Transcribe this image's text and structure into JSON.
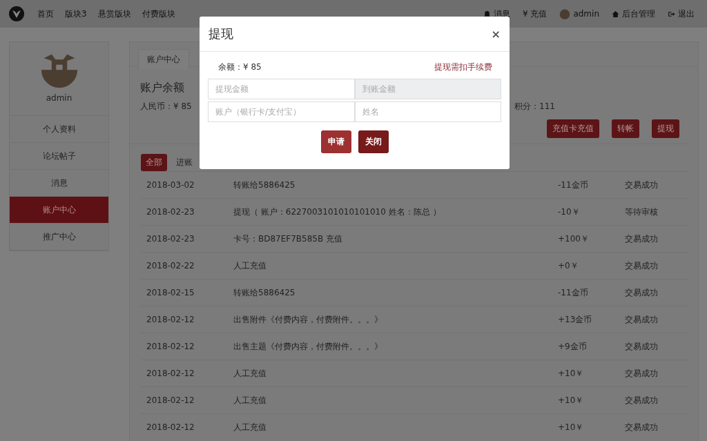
{
  "navbar": {
    "left": [
      {
        "label": "首页"
      },
      {
        "label": "版块3"
      },
      {
        "label": "悬赏版块"
      },
      {
        "label": "付费版块"
      }
    ],
    "right": [
      {
        "kind": "bell",
        "label": "消息"
      },
      {
        "kind": "text",
        "label": "¥ 充值"
      },
      {
        "kind": "avatar",
        "label": "admin"
      },
      {
        "kind": "home",
        "label": "后台管理"
      },
      {
        "kind": "exit",
        "label": "退出"
      }
    ]
  },
  "sidebar": {
    "username": "admin",
    "items": [
      {
        "label": "个人资料",
        "selected": false
      },
      {
        "label": "论坛帖子",
        "selected": false
      },
      {
        "label": "消息",
        "selected": false
      },
      {
        "label": "账户中心",
        "selected": true
      },
      {
        "label": "推广中心",
        "selected": false
      }
    ]
  },
  "panel": {
    "tab": "账户中心",
    "heading": "账户余额",
    "rmb": "人民币：¥ 85",
    "points": "积分：111",
    "actions": [
      "充值卡充值",
      "转帐",
      "提现"
    ],
    "filters": [
      {
        "label": "全部",
        "selected": true
      },
      {
        "label": "进账",
        "selected": false
      }
    ],
    "rows": [
      {
        "date": "2018-03-02",
        "desc": "转账给5886425",
        "amount": "-11金币",
        "status": "交易成功"
      },
      {
        "date": "2018-02-23",
        "desc": "提现（ 账户：6227003101010101010 姓名：陈总 ）",
        "amount": "-10￥",
        "status": "等待审核"
      },
      {
        "date": "2018-02-23",
        "desc": "卡号：BD87EF7B585B 充值",
        "amount": "+100￥",
        "status": "交易成功"
      },
      {
        "date": "2018-02-22",
        "desc": "人工充值",
        "amount": "+0￥",
        "status": "交易成功"
      },
      {
        "date": "2018-02-15",
        "desc": "转账给5886425",
        "amount": "-11金币",
        "status": "交易成功"
      },
      {
        "date": "2018-02-12",
        "desc": "出售附件《付费内容，付费附件。。。》",
        "amount": "+13金币",
        "status": "交易成功"
      },
      {
        "date": "2018-02-12",
        "desc": "出售主题《付费内容，付费附件。。。》",
        "amount": "+9金币",
        "status": "交易成功"
      },
      {
        "date": "2018-02-12",
        "desc": "人工充值",
        "amount": "+10￥",
        "status": "交易成功"
      },
      {
        "date": "2018-02-12",
        "desc": "人工充值",
        "amount": "+10￥",
        "status": "交易成功"
      },
      {
        "date": "2018-02-12",
        "desc": "人工充值",
        "amount": "+10￥",
        "status": "交易成功"
      }
    ]
  },
  "modal": {
    "title": "提现",
    "close": "×",
    "balance": "余额：¥ 85",
    "fee_note": "提现需扣手续费",
    "fields": [
      {
        "placeholder": "提现金额",
        "disabled": false
      },
      {
        "placeholder": "到账金额",
        "disabled": true
      },
      {
        "placeholder": "账户（银行卡/支付宝）",
        "disabled": false
      },
      {
        "placeholder": "姓名",
        "disabled": false
      }
    ],
    "buttons": [
      "申请",
      "关闭"
    ]
  }
}
